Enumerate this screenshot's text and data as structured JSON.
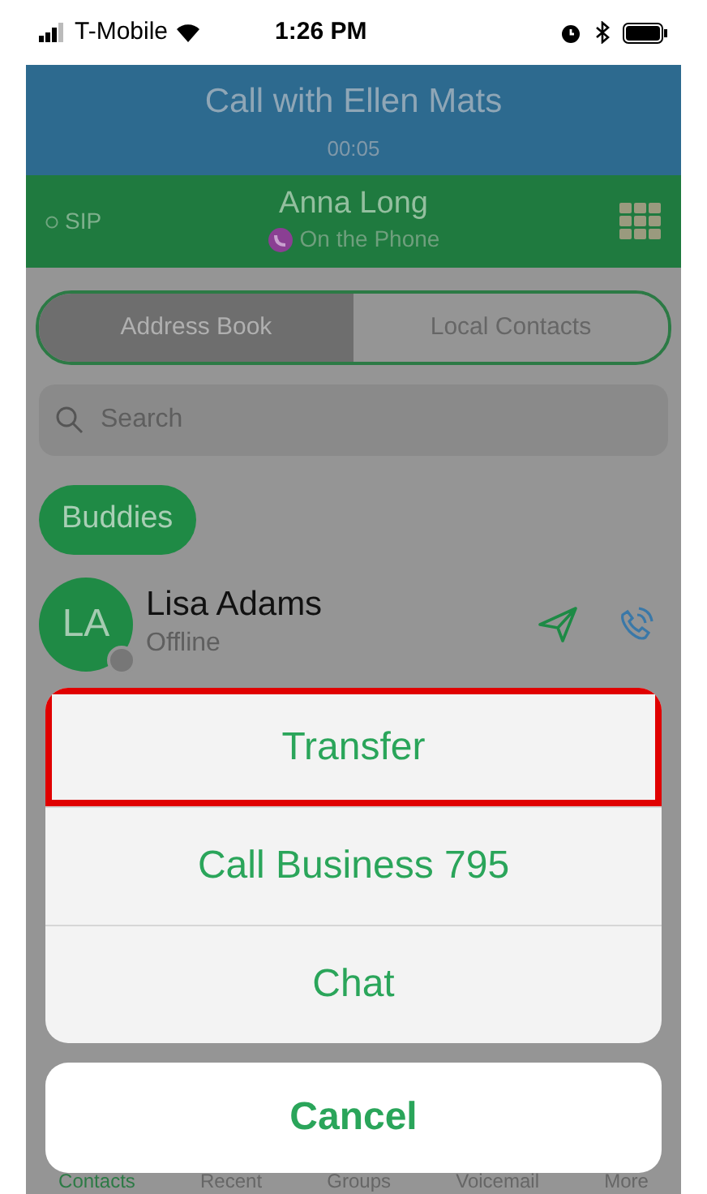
{
  "status_bar": {
    "carrier": "T-Mobile",
    "time": "1:26 PM"
  },
  "header": {
    "title": "Call with Ellen Mats",
    "duration": "00:05"
  },
  "call_bar": {
    "account": "SIP",
    "name": "Anna Long",
    "presence": "On the Phone"
  },
  "segments": [
    {
      "label": "Address Book",
      "selected": true
    },
    {
      "label": "Local Contacts",
      "selected": false
    }
  ],
  "search": {
    "placeholder": "Search"
  },
  "group": {
    "label": "Buddies"
  },
  "contacts": [
    {
      "initials": "LA",
      "name": "Lisa Adams",
      "status": "Offline"
    }
  ],
  "action_sheet": {
    "actions": [
      {
        "label": "Transfer",
        "highlighted": true
      },
      {
        "label": "Call Business 795",
        "highlighted": false
      },
      {
        "label": "Chat",
        "highlighted": false
      }
    ],
    "cancel": "Cancel"
  },
  "tab_bar": [
    {
      "label": "Contacts",
      "selected": true
    },
    {
      "label": "Recent",
      "selected": false
    },
    {
      "label": "Groups",
      "selected": false
    },
    {
      "label": "Voicemail",
      "selected": false
    },
    {
      "label": "More",
      "selected": false
    }
  ]
}
